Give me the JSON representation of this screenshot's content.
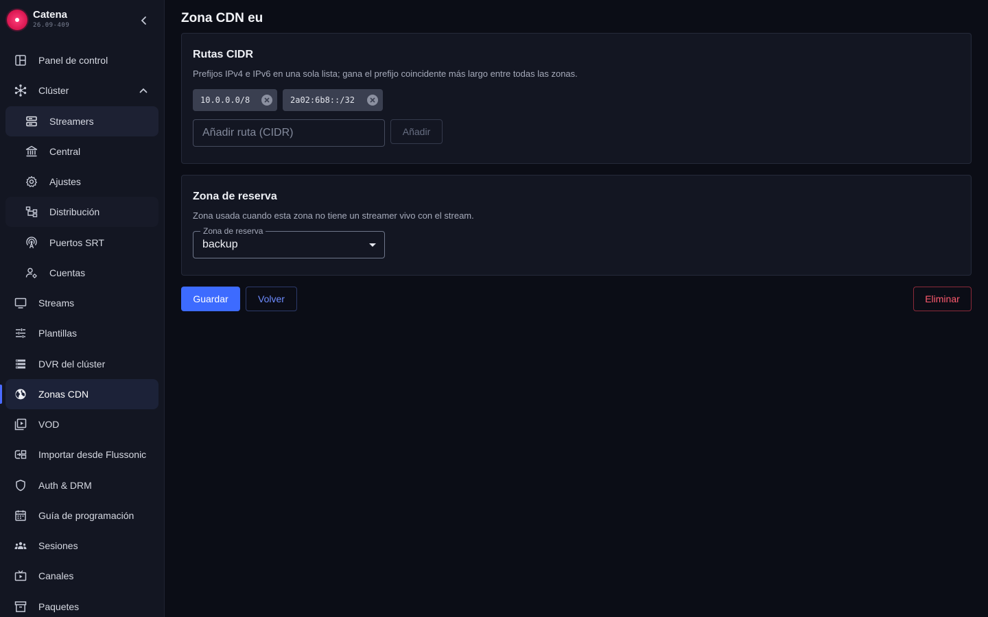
{
  "app": {
    "name": "Catena",
    "version": "26.09-409"
  },
  "sidebar": {
    "items": [
      {
        "label": "Panel de control",
        "icon": "dashboard-icon"
      },
      {
        "label": "Clúster",
        "icon": "cluster-icon"
      },
      {
        "label": "Streamers",
        "icon": "server-icon"
      },
      {
        "label": "Central",
        "icon": "bank-icon"
      },
      {
        "label": "Ajustes",
        "icon": "gear-icon"
      },
      {
        "label": "Distribución",
        "icon": "hierarchy-icon"
      },
      {
        "label": "Puertos SRT",
        "icon": "antenna-icon"
      },
      {
        "label": "Cuentas",
        "icon": "user-settings-icon"
      },
      {
        "label": "Streams",
        "icon": "monitor-icon"
      },
      {
        "label": "Plantillas",
        "icon": "tune-icon"
      },
      {
        "label": "DVR del clúster",
        "icon": "storage-icon"
      },
      {
        "label": "Zonas CDN",
        "icon": "globe-icon"
      },
      {
        "label": "VOD",
        "icon": "video-library-icon"
      },
      {
        "label": "Importar desde Flussonic",
        "icon": "import-icon"
      },
      {
        "label": "Auth & DRM",
        "icon": "shield-icon"
      },
      {
        "label": "Guía de programación",
        "icon": "calendar-icon"
      },
      {
        "label": "Sesiones",
        "icon": "groups-icon"
      },
      {
        "label": "Canales",
        "icon": "tv-icon"
      },
      {
        "label": "Paquetes",
        "icon": "archive-icon"
      }
    ]
  },
  "page": {
    "title": "Zona CDN eu"
  },
  "cidr": {
    "title": "Rutas CIDR",
    "description": "Prefijos IPv4 e IPv6 en una sola lista; gana el prefijo coincidente más largo entre todas las zonas.",
    "routes": [
      "10.0.0.0/8",
      "2a02:6b8::/32"
    ],
    "input_placeholder": "Añadir ruta (CIDR)",
    "add_label": "Añadir"
  },
  "fallback": {
    "title": "Zona de reserva",
    "description": "Zona usada cuando esta zona no tiene un streamer vivo con el stream.",
    "select_label": "Zona de reserva",
    "select_value": "backup"
  },
  "actions": {
    "save": "Guardar",
    "back": "Volver",
    "delete": "Eliminar"
  },
  "colors": {
    "accent": "#3d6bff",
    "danger": "#ff5a6e",
    "brand": "#d8154f"
  }
}
